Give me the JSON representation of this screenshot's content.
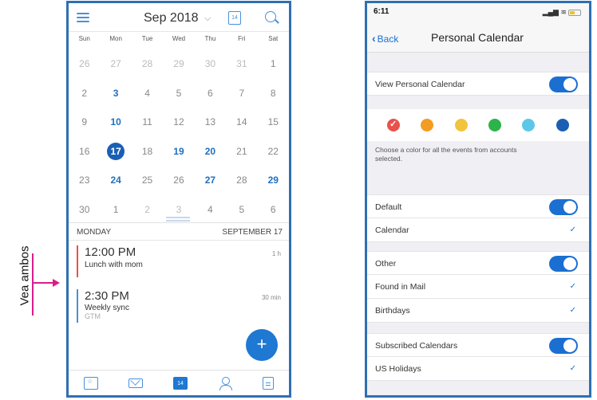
{
  "annotation": {
    "text": "Vea ambos",
    "color": "#d91e8a"
  },
  "left": {
    "header": {
      "title": "Sep 2018",
      "today_icon_text": "14"
    },
    "weekdays": [
      "Sun",
      "Mon",
      "Tue",
      "Wed",
      "Thu",
      "Fri",
      "Sat"
    ],
    "weeks": [
      [
        "26",
        "27",
        "28",
        "29",
        "30",
        "31",
        "1"
      ],
      [
        "2",
        "3",
        "4",
        "5",
        "6",
        "7",
        "8"
      ],
      [
        "9",
        "10",
        "11",
        "12",
        "13",
        "14",
        "15"
      ],
      [
        "16",
        "17",
        "18",
        "19",
        "20",
        "21",
        "22"
      ],
      [
        "23",
        "24",
        "25",
        "26",
        "27",
        "28",
        "29"
      ],
      [
        "30",
        "1",
        "2",
        "3",
        "4",
        "5",
        "6"
      ]
    ],
    "selected_day": "17",
    "agenda": {
      "day": "MONDAY",
      "date": "SEPTEMBER 17"
    },
    "events": [
      {
        "time": "12:00 PM",
        "title": "Lunch with mom",
        "location": "",
        "duration": "1 h",
        "color": "#e8524a"
      },
      {
        "time": "2:30 PM",
        "title": "Weekly sync",
        "location": "GTM",
        "duration": "30 min",
        "color": "#4a90d9"
      }
    ],
    "fab": "+",
    "tabs": [
      "calendar-star",
      "mail",
      "calendar",
      "people",
      "files"
    ],
    "accent": "#1f78d1"
  },
  "right": {
    "status": {
      "time": "6:11"
    },
    "nav": {
      "back": "Back",
      "title": "Personal Calendar"
    },
    "view_toggle": {
      "label": "View Personal Calendar",
      "on": true
    },
    "colors": [
      "#e8524a",
      "#f39c24",
      "#f2c43d",
      "#2cb34a",
      "#5bc8e8",
      "#1a5fb4"
    ],
    "selected_color": 0,
    "helper": "Choose a color for all the events from accounts selected.",
    "sections": {
      "default": {
        "label": "Default",
        "items": [
          "Calendar"
        ]
      },
      "other": {
        "label": "Other",
        "items": [
          "Found in Mail",
          "Birthdays"
        ]
      },
      "subscribed": {
        "label": "Subscribed Calendars",
        "items": [
          "US Holidays"
        ]
      }
    },
    "accent": "#1a6fd1"
  }
}
